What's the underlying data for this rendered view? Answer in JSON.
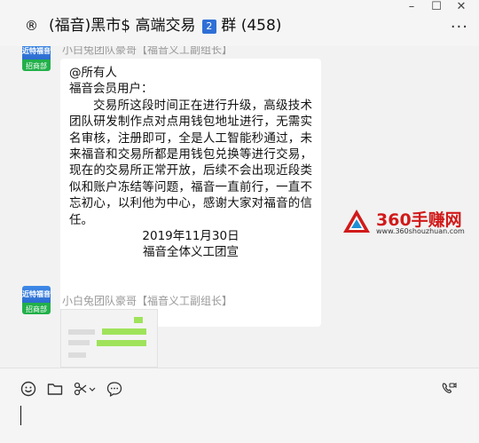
{
  "window": {
    "pre_icon": "®",
    "title": "(福音)黑市$ 高端交易",
    "badge": "2",
    "group_label": "群 (458)",
    "controls": {
      "minimize": "–",
      "maximize": "☐",
      "close": "✕"
    },
    "more": "···"
  },
  "messages": [
    {
      "sender": "小白兔团队豪哥【福音义工副组长】",
      "avatar_text": [
        "近特福音",
        "招商部"
      ],
      "lines": [
        "@所有人",
        "福音会员用户：",
        "交易所这段时间正在进行升级，高级技术团队研发制作点对点用钱包地址进行，无需实名审核，注册即可，全是人工智能秒通过，未来福音和交易所都是用钱包兑换等进行交易，现在的交易所正常开放，后续不会出现近段类似和账户冻结等问题，福音一直前行，一直不忘初心，以利他为中心，感谢大家对福音的信任。",
        "2019年11月30日",
        "福音全体义工团宣"
      ]
    },
    {
      "sender": "小白兔团队豪哥【福音义工副组长】",
      "avatar_text": [
        "近特福音",
        "招商部"
      ],
      "type": "image"
    }
  ],
  "watermark": {
    "title": "360手赚网",
    "url": "www.360shouzhuan.com"
  },
  "toolbar": {
    "icons": [
      "emoji-icon",
      "folder-icon",
      "scissors-icon",
      "chat-history-icon",
      "video-call-icon"
    ]
  },
  "colors": {
    "background": "#f2f2f2",
    "bubble": "#ffffff",
    "watermark_red": "#d11a1a",
    "badge_blue": "#2f6fd6",
    "wechat_green": "#9fe35b"
  }
}
